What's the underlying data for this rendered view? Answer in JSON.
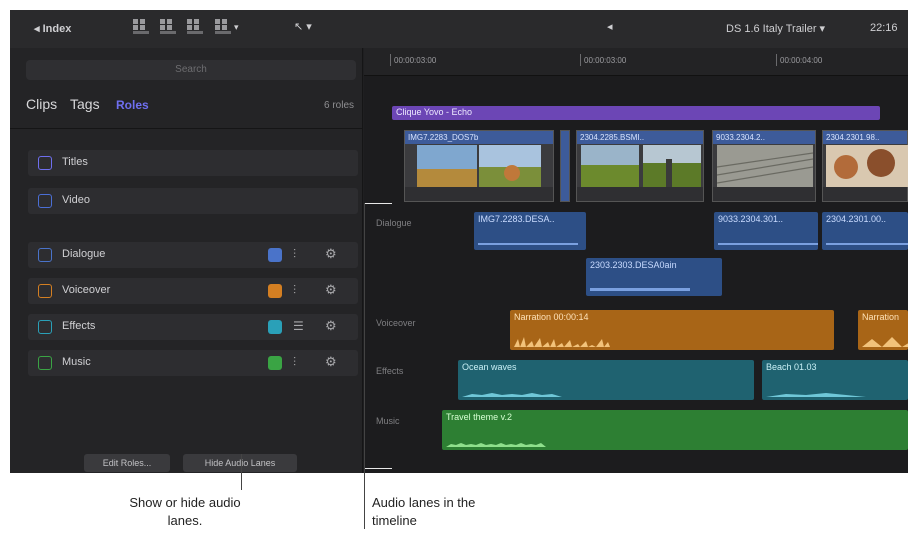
{
  "toolbar": {
    "library_button": "◂ Index",
    "tool_menu": "↖ ▾",
    "center_icon": "◂",
    "project_name": "DS 1.6 Italy Trailer ▾",
    "timecode": "22:16"
  },
  "sidebar": {
    "search_placeholder": "Search",
    "tabs": [
      "Clips",
      "Tags",
      "Roles"
    ],
    "role_count": "6 roles",
    "video_roles": [
      {
        "label": "Titles",
        "color": "#6f6ff0"
      },
      {
        "label": "Video",
        "color": "#4b6fd6"
      }
    ],
    "audio_roles": [
      {
        "label": "Dialogue",
        "color": "#4a73c9"
      },
      {
        "label": "Voiceover",
        "color": "#d47f22"
      },
      {
        "label": "Effects",
        "color": "#2aa0b8"
      },
      {
        "label": "Music",
        "color": "#3aa444"
      }
    ],
    "edit_roles_button": "Edit Roles...",
    "hide_audio_lanes_button": "Hide Audio Lanes"
  },
  "timeline": {
    "ruler": [
      "00:00:03:00",
      "00:00:03:00",
      "00:00:04:00"
    ],
    "storyline_label": "Clique Yovo - Echo",
    "video_clips": [
      {
        "name": "IMG7.2283_DOS7b"
      },
      {
        "name": "2304.2285.BSMI.."
      },
      {
        "name": "9033.2304.2.."
      },
      {
        "name": "2304.2301.98.."
      }
    ],
    "lanes": {
      "dialogue": "Dialogue",
      "voiceover": "Voiceover",
      "effects": "Effects",
      "music": "Music"
    },
    "dialogue_clips": [
      "IMG7.2283.DESA..",
      "9033.2304.301..",
      "2304.2301.00..",
      "2303.2303.DESA0ain"
    ],
    "voiceover_clips": [
      "Narration 00:00:14",
      "Narration"
    ],
    "effects_clips": [
      "Ocean waves",
      "Beach 01.03"
    ],
    "music_clips": [
      "Travel theme v.2"
    ]
  },
  "callouts": {
    "show_hide": "Show or hide audio lanes.",
    "audio_lanes": "Audio lanes in the timeline"
  }
}
